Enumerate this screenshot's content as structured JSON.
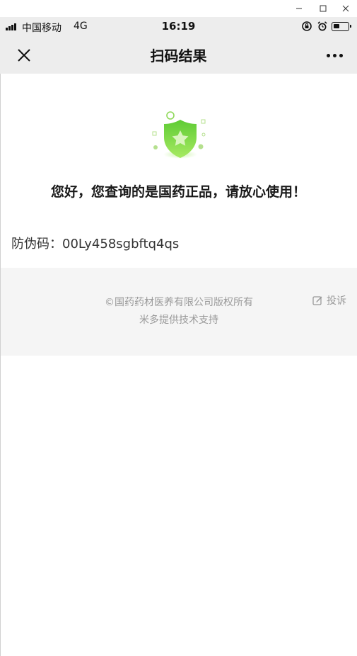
{
  "window": {
    "min_icon": "minimize-icon",
    "max_icon": "maximize-icon",
    "close_icon": "close-icon"
  },
  "status_bar": {
    "carrier": "中国移动",
    "network": "4G",
    "time": "16:19",
    "icons": [
      "signal-icon",
      "rotation-lock-icon",
      "alarm-icon",
      "battery-icon"
    ],
    "battery_level": 0.45
  },
  "nav": {
    "title": "扫码结果",
    "close_icon": "close-icon",
    "more_icon": "more-icon"
  },
  "result": {
    "icon": "verified-shield-icon",
    "message": "您好，您查询的是国药正品，请放心使用！",
    "code_label": "防伪码：",
    "code_value": "00Ly458sgbftq4qs"
  },
  "footer": {
    "copyright": "©国药药材医养有限公司版权所有",
    "powered_by": "米多提供技术支持",
    "complain_label": "投诉",
    "complain_icon": "edit-icon"
  },
  "colors": {
    "nav_bg": "#ededed",
    "footer_bg": "#f5f5f5",
    "accent_green": "#6dd33e",
    "muted_text": "#999999"
  }
}
